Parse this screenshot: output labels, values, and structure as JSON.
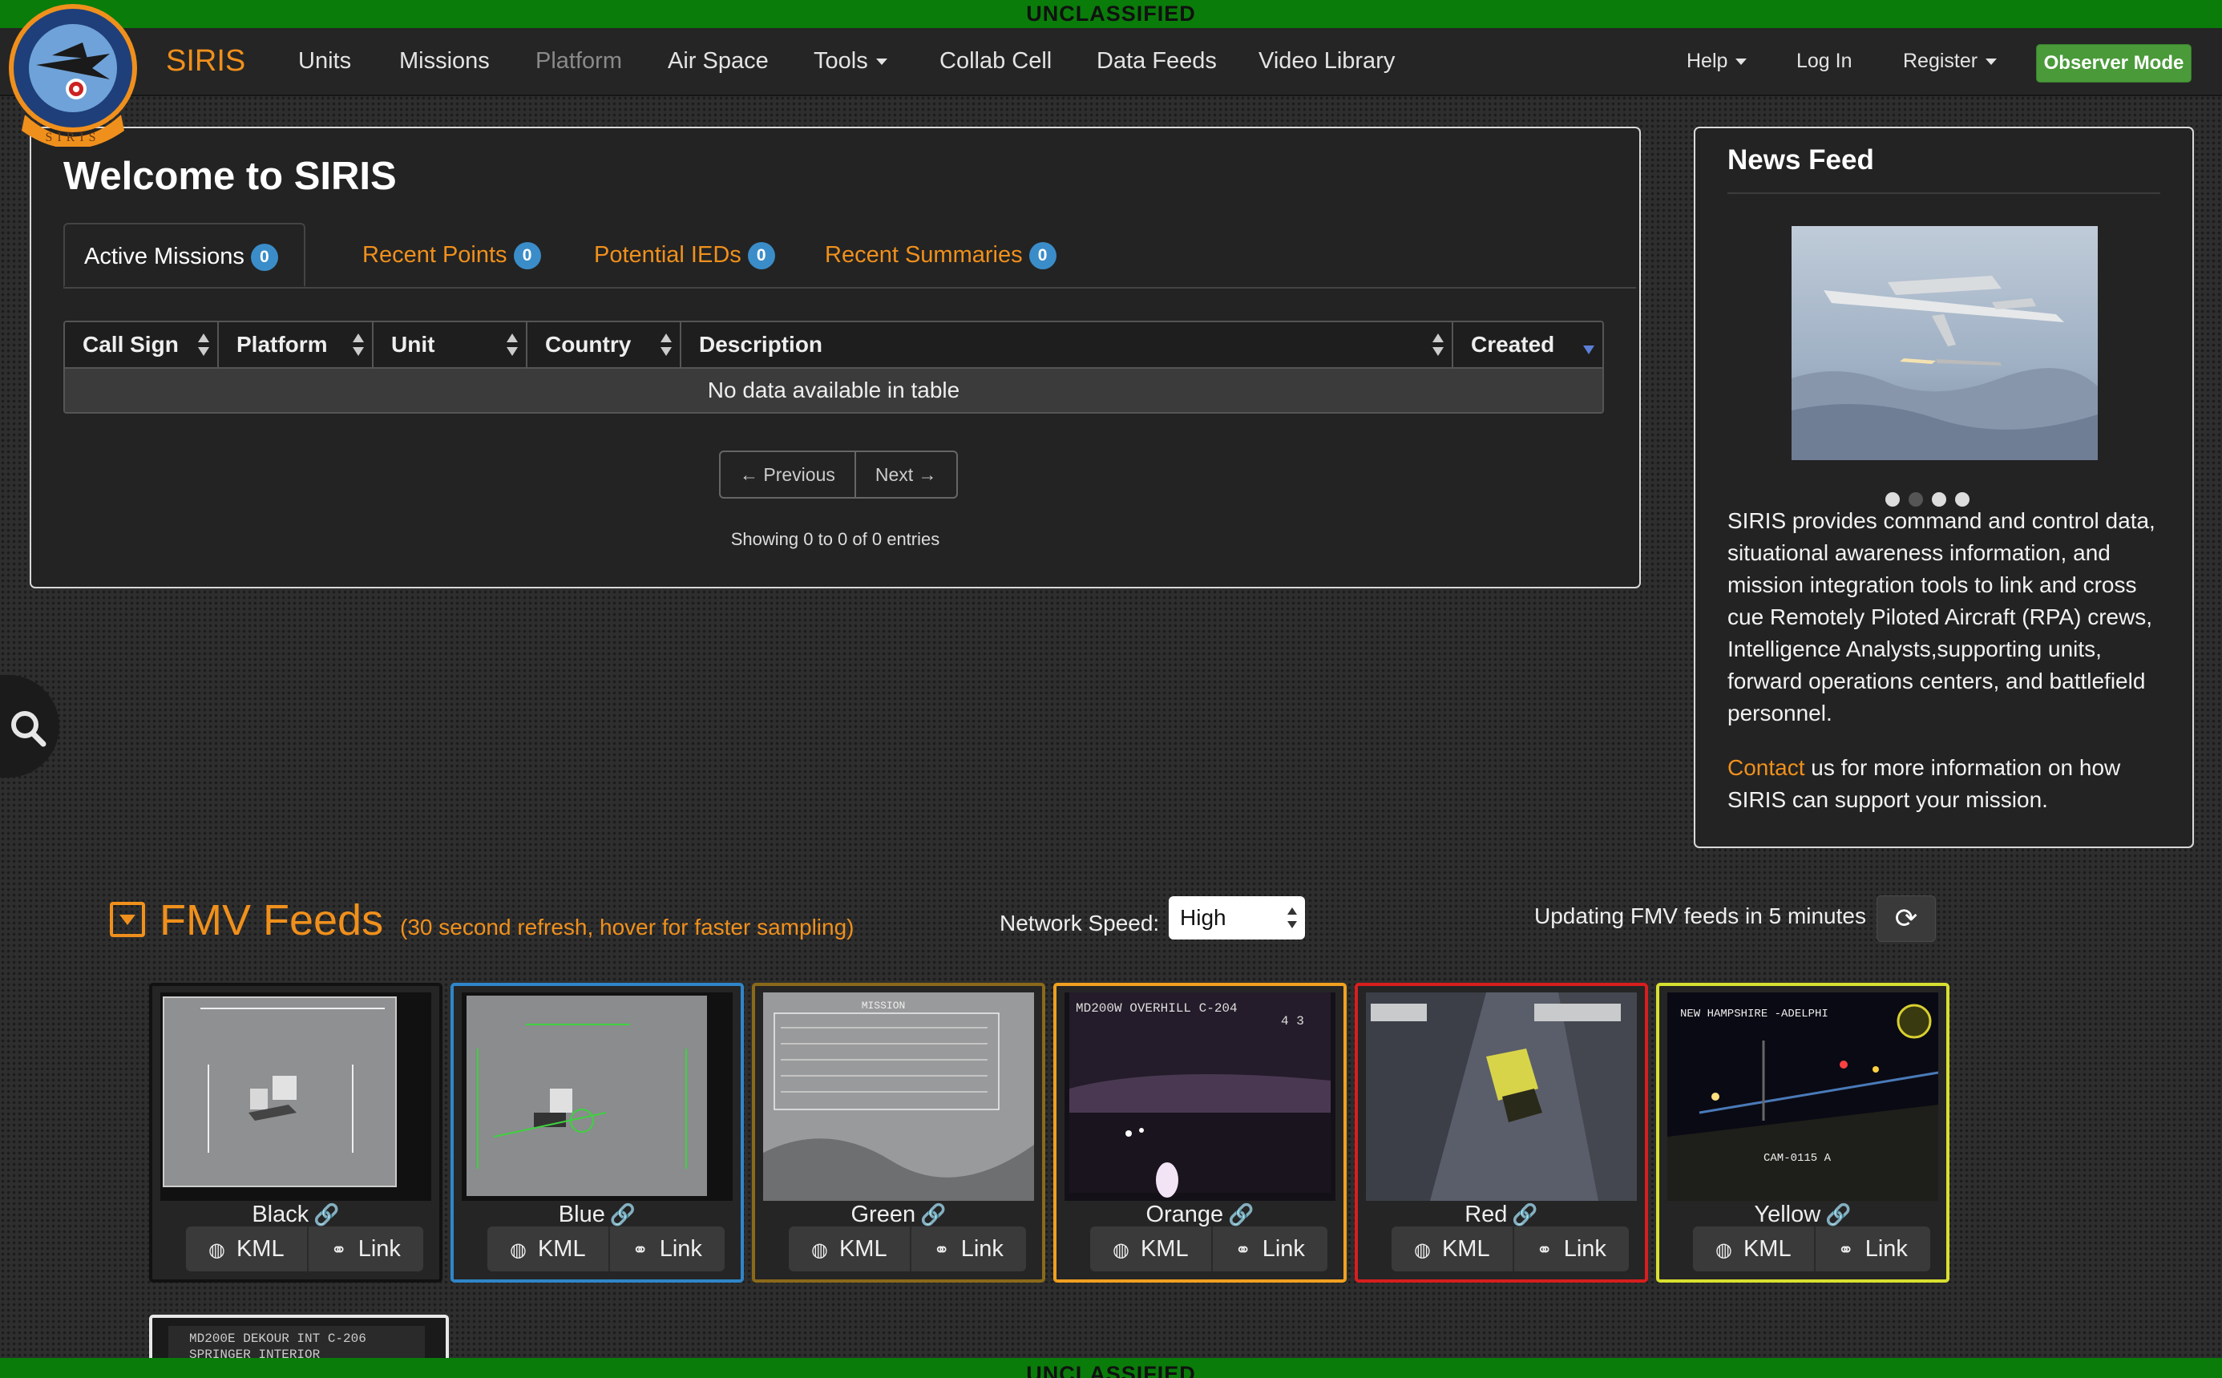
{
  "classification": {
    "top": "UNCLASSIFIED",
    "bottom": "UNCLASSIFIED"
  },
  "logo": {
    "ring_text": "SIRIS"
  },
  "nav": {
    "brand": "SIRIS",
    "items": [
      {
        "label": "Units"
      },
      {
        "label": "Missions"
      },
      {
        "label": "Platform"
      },
      {
        "label": "Air Space"
      },
      {
        "label": "Tools"
      },
      {
        "label": "Collab Cell"
      },
      {
        "label": "Data Feeds"
      },
      {
        "label": "Video Library"
      }
    ],
    "right": {
      "help": "Help",
      "login": "Log In",
      "register": "Register",
      "observer": "Observer Mode"
    }
  },
  "welcome": {
    "title": "Welcome to SIRIS",
    "tabs": [
      {
        "label": "Active Missions",
        "count": "0"
      },
      {
        "label": "Recent Points",
        "count": "0"
      },
      {
        "label": "Potential IEDs",
        "count": "0"
      },
      {
        "label": "Recent Summaries",
        "count": "0"
      }
    ],
    "columns": [
      "Call Sign",
      "Platform",
      "Unit",
      "Country",
      "Description",
      "Created"
    ],
    "empty_message": "No data available in table",
    "pager": {
      "prev": "← Previous",
      "next": "Next →"
    },
    "showing": "Showing 0 to 0 of 0 entries"
  },
  "news": {
    "title": "News Feed",
    "body": "SIRIS provides command and control data, situational awareness information, and mission integration tools to link and cross cue Remotely Piloted Aircraft (RPA) crews, Intelligence Analysts,supporting units, forward operations centers, and battlefield personnel.",
    "contact_link": "Contact",
    "contact_rest": " us for more information on how SIRIS can support your mission."
  },
  "fmv": {
    "title": "FMV Feeds",
    "subtitle": "(30 second refresh, hover for faster sampling)",
    "network_speed_label": "Network Speed:",
    "network_speed_value": "High",
    "updating": "Updating FMV feeds in 5 minutes",
    "kml_label": "KML",
    "link_label": "Link",
    "feeds": [
      {
        "name": "Black",
        "border": "#111111",
        "linked": true
      },
      {
        "name": "Blue",
        "border": "#2f86c9",
        "linked": true
      },
      {
        "name": "Green",
        "border": "#8a6a1a",
        "linked": true
      },
      {
        "name": "Orange",
        "border": "#f0a020",
        "linked": true
      },
      {
        "name": "Red",
        "border": "#d81e1e",
        "linked": false
      },
      {
        "name": "Yellow",
        "border": "#d8e030",
        "linked": true
      }
    ],
    "overlays": {
      "green_header": "MISSION",
      "orange_header": "MD200W OVERHILL C-204",
      "orange_sub": "4 3",
      "yellow_header": "NEW HAMPSHIRE -ADELPHI",
      "yellow_cam": "CAM-0115 A",
      "partial_header": "MD200E DEKOUR INT C-206",
      "partial_sub": "SPRINGER INTERIOR"
    }
  }
}
